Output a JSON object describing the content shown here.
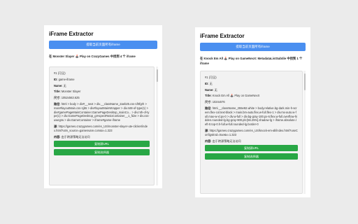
{
  "panels": [
    {
      "title": "iFrame Extractor",
      "extract_button": "提取当前页面所有iframe",
      "summary": "在 Monster Slayer 🕹️ Play on CrazyGames 中找到 4 个 iframe",
      "entry": {
        "number": "#1 (可见)",
        "id_label": "ID:",
        "id_value": "game-iframe",
        "name_label": "Name:",
        "name_value": "无",
        "title_label": "Title:",
        "title_value": "Monster Slayer",
        "size_label": "尺寸:",
        "size_value": "1052x563.625",
        "path_label": "路径:",
        "path_value": "html > body > div#__next > div.__className_2aeb25.css-1f0fgrh > main#layoutMain.css-1jb5 > div#layoutMainWrapper > div.mt8-of-type(1) > div#gamePageMainContainer.GamePageDesktop_mainCo... > div:nth-of-type(1) > div.GamePageDesktop_gIAspectRatioContainer__1_fdJe > div.css-uwegrw > div.GameContainer > iframe#game-iframe",
        "source_label": "源:",
        "source_value": "https://games.crazygames.com/en_US/monster-slayer-ute-clicker/index.html?utm_source=gamesvare.com&v=1.323",
        "content_label": "内容:",
        "content_value": "由于跨源策略无法访问",
        "copy_url_button": "复制源URL",
        "copy_selector_button": "复制选择器"
      }
    },
    {
      "title": "iFrame Extractor",
      "extract_button": "提取当前页面所有iframe",
      "summary": "在 Knock Em All 🕹️ Play on GameNexX: MetadataListSubtile 中找到 1 个 iframe",
      "entry": {
        "number": "#1 (可见)",
        "id_label": "ID:",
        "id_value": "无",
        "name_label": "Name:",
        "name_value": "无",
        "title_label": "Title:",
        "title_value": "Knock Em All 🕹️ Play on GameNexX",
        "size_label": "尺寸:",
        "size_value": "1024x576",
        "path_label": "路径:",
        "path_value": "html.__className_255e92.white > body.relative.bg-dark.min-h-screen.flex-col.text-black > main.bm-auto.flex.w-full.flex-1 > div.mx-auto.w-full.max-w-xl.px-0 > div.w-full > div.bg-gray-100.px-6.flex.w-full.overflow-hidden.rounded-lg.bg-gray-900.pb-[56.25%].shadow-lg > iframe.absolute.left-0.top-0.h-full.w-full.rounded-lg.border-0",
        "source_label": "源:",
        "source_value": "https://games.crazygames.com/en_US/knock-em-all/index.html?useConfigsEnd=true&v=1.323",
        "content_label": "内容:",
        "content_value": "由于跨源策略无法访问",
        "copy_url_button": "复制源URL",
        "copy_selector_button": "复制选择器"
      }
    }
  ]
}
